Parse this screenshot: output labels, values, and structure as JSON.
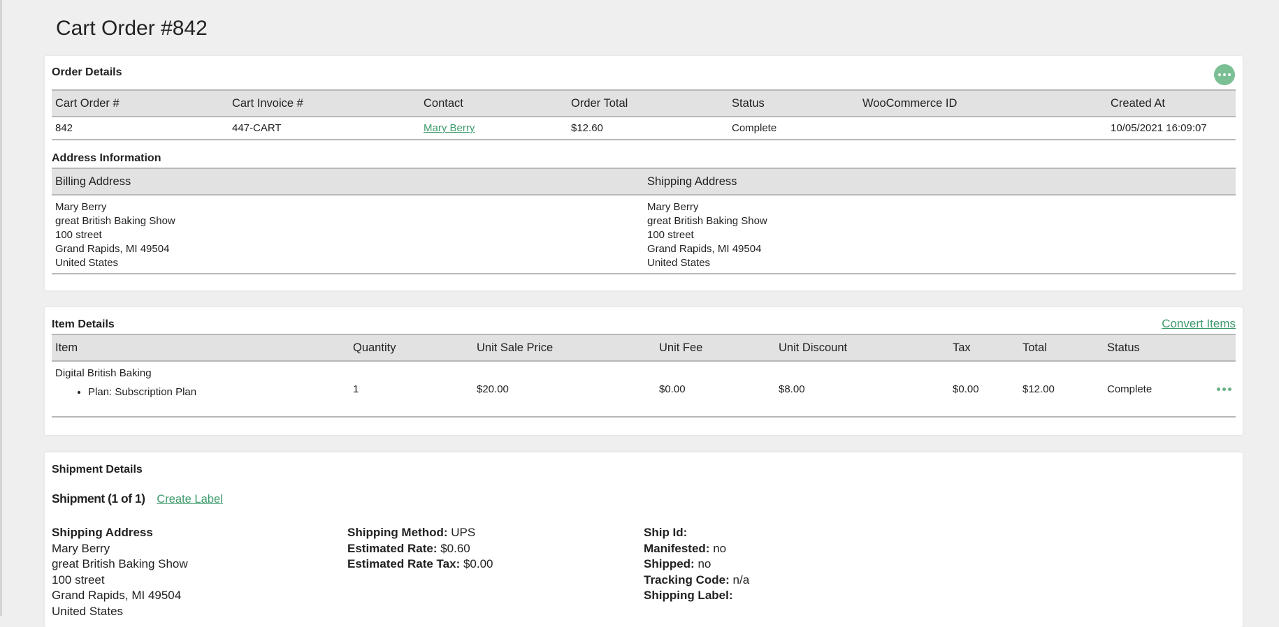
{
  "page_title": "Cart Order #842",
  "order_details": {
    "title": "Order Details",
    "columns": [
      "Cart Order #",
      "Cart Invoice #",
      "Contact",
      "Order Total",
      "Status",
      "WooCommerce ID",
      "Created At"
    ],
    "row": {
      "cart_order": "842",
      "cart_invoice": "447-CART",
      "contact": "Mary Berry",
      "order_total": "$12.60",
      "status": "Complete",
      "woocommerce_id": "",
      "created_at": "10/05/2021 16:09:07"
    }
  },
  "address_info": {
    "title": "Address Information",
    "billing_header": "Billing Address",
    "shipping_header": "Shipping Address",
    "billing_lines": [
      "Mary Berry",
      "great British Baking Show",
      "100 street",
      "Grand Rapids, MI 49504",
      "United States"
    ],
    "shipping_lines": [
      "Mary Berry",
      "great British Baking Show",
      "100 street",
      "Grand Rapids, MI 49504",
      "United States"
    ]
  },
  "item_details": {
    "title": "Item Details",
    "convert_link": "Convert Items",
    "columns": [
      "Item",
      "Quantity",
      "Unit Sale Price",
      "Unit Fee",
      "Unit Discount",
      "Tax",
      "Total",
      "Status"
    ],
    "row": {
      "item": "Digital British Baking",
      "sub_item": "Plan: Subscription Plan",
      "quantity": "1",
      "unit_sale_price": "$20.00",
      "unit_fee": "$0.00",
      "unit_discount": "$8.00",
      "tax": "$0.00",
      "total": "$12.00",
      "status": "Complete"
    }
  },
  "shipment_details": {
    "title": "Shipment Details",
    "shipment_heading": "Shipment (1 of 1)",
    "create_label": "Create Label",
    "address_label": "Shipping Address",
    "address_lines": [
      "Mary Berry",
      "great British Baking Show",
      "100 street",
      "Grand Rapids, MI 49504",
      "United States"
    ],
    "method_label": "Shipping Method:",
    "method_value": "UPS",
    "rate_label": "Estimated Rate:",
    "rate_value": "$0.60",
    "rate_tax_label": "Estimated Rate Tax:",
    "rate_tax_value": "$0.00",
    "ship_id_label": "Ship Id:",
    "ship_id_value": "",
    "manifested_label": "Manifested:",
    "manifested_value": "no",
    "shipped_label": "Shipped:",
    "shipped_value": "no",
    "tracking_label": "Tracking Code:",
    "tracking_value": "n/a",
    "shipping_label_label": "Shipping Label:",
    "shipping_label_value": ""
  },
  "colors": {
    "accent": "#3d9b6b",
    "header_bg": "#e2e2e2",
    "page_bg": "#efefef"
  }
}
